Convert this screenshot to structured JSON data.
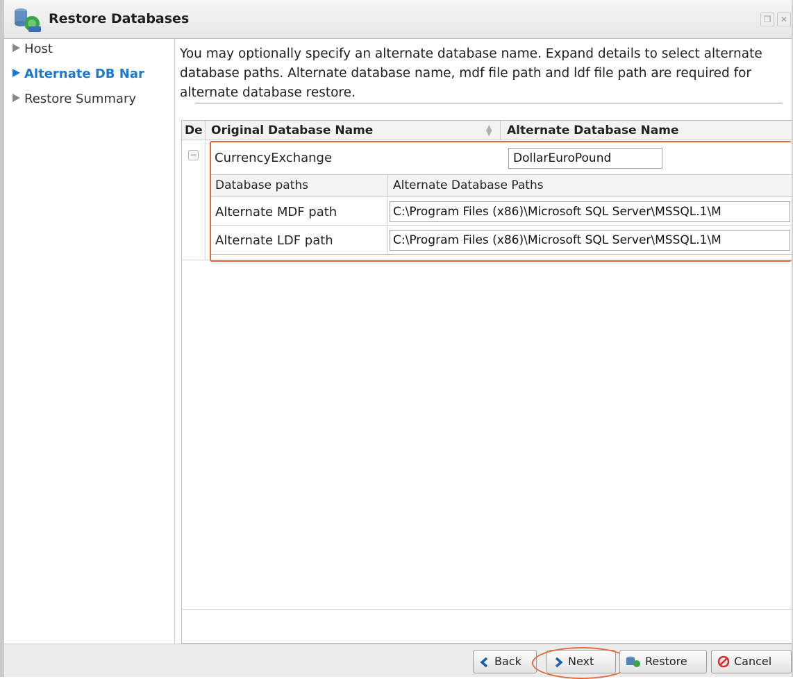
{
  "window": {
    "title": "Restore Databases"
  },
  "sidebar": {
    "items": [
      {
        "label": "Host"
      },
      {
        "label": "Alternate DB Nar"
      },
      {
        "label": "Restore Summary"
      }
    ]
  },
  "main": {
    "description": "You may optionally specify an alternate database name. Expand details to select alternate database paths. Alternate database name, mdf file path and ldf file path are required for alternate database restore.",
    "grid": {
      "columns": [
        "De",
        "Original Database Name",
        "Alternate Database Name"
      ],
      "row": {
        "original_name": "CurrencyExchange",
        "alternate_name": "DollarEuroPound",
        "details": {
          "columns": [
            "Database paths",
            "Alternate Database Paths"
          ],
          "rows": [
            {
              "label": "Alternate MDF path",
              "value": "C:\\Program Files (x86)\\Microsoft SQL Server\\MSSQL.1\\M"
            },
            {
              "label": "Alternate LDF path",
              "value": "C:\\Program Files (x86)\\Microsoft SQL Server\\MSSQL.1\\M"
            }
          ]
        }
      }
    }
  },
  "footer": {
    "back_label": "Back",
    "next_label": "Next",
    "restore_label": "Restore",
    "cancel_label": "Cancel"
  },
  "colors": {
    "accent": "#1a78d1",
    "highlight": "#e2693a"
  }
}
